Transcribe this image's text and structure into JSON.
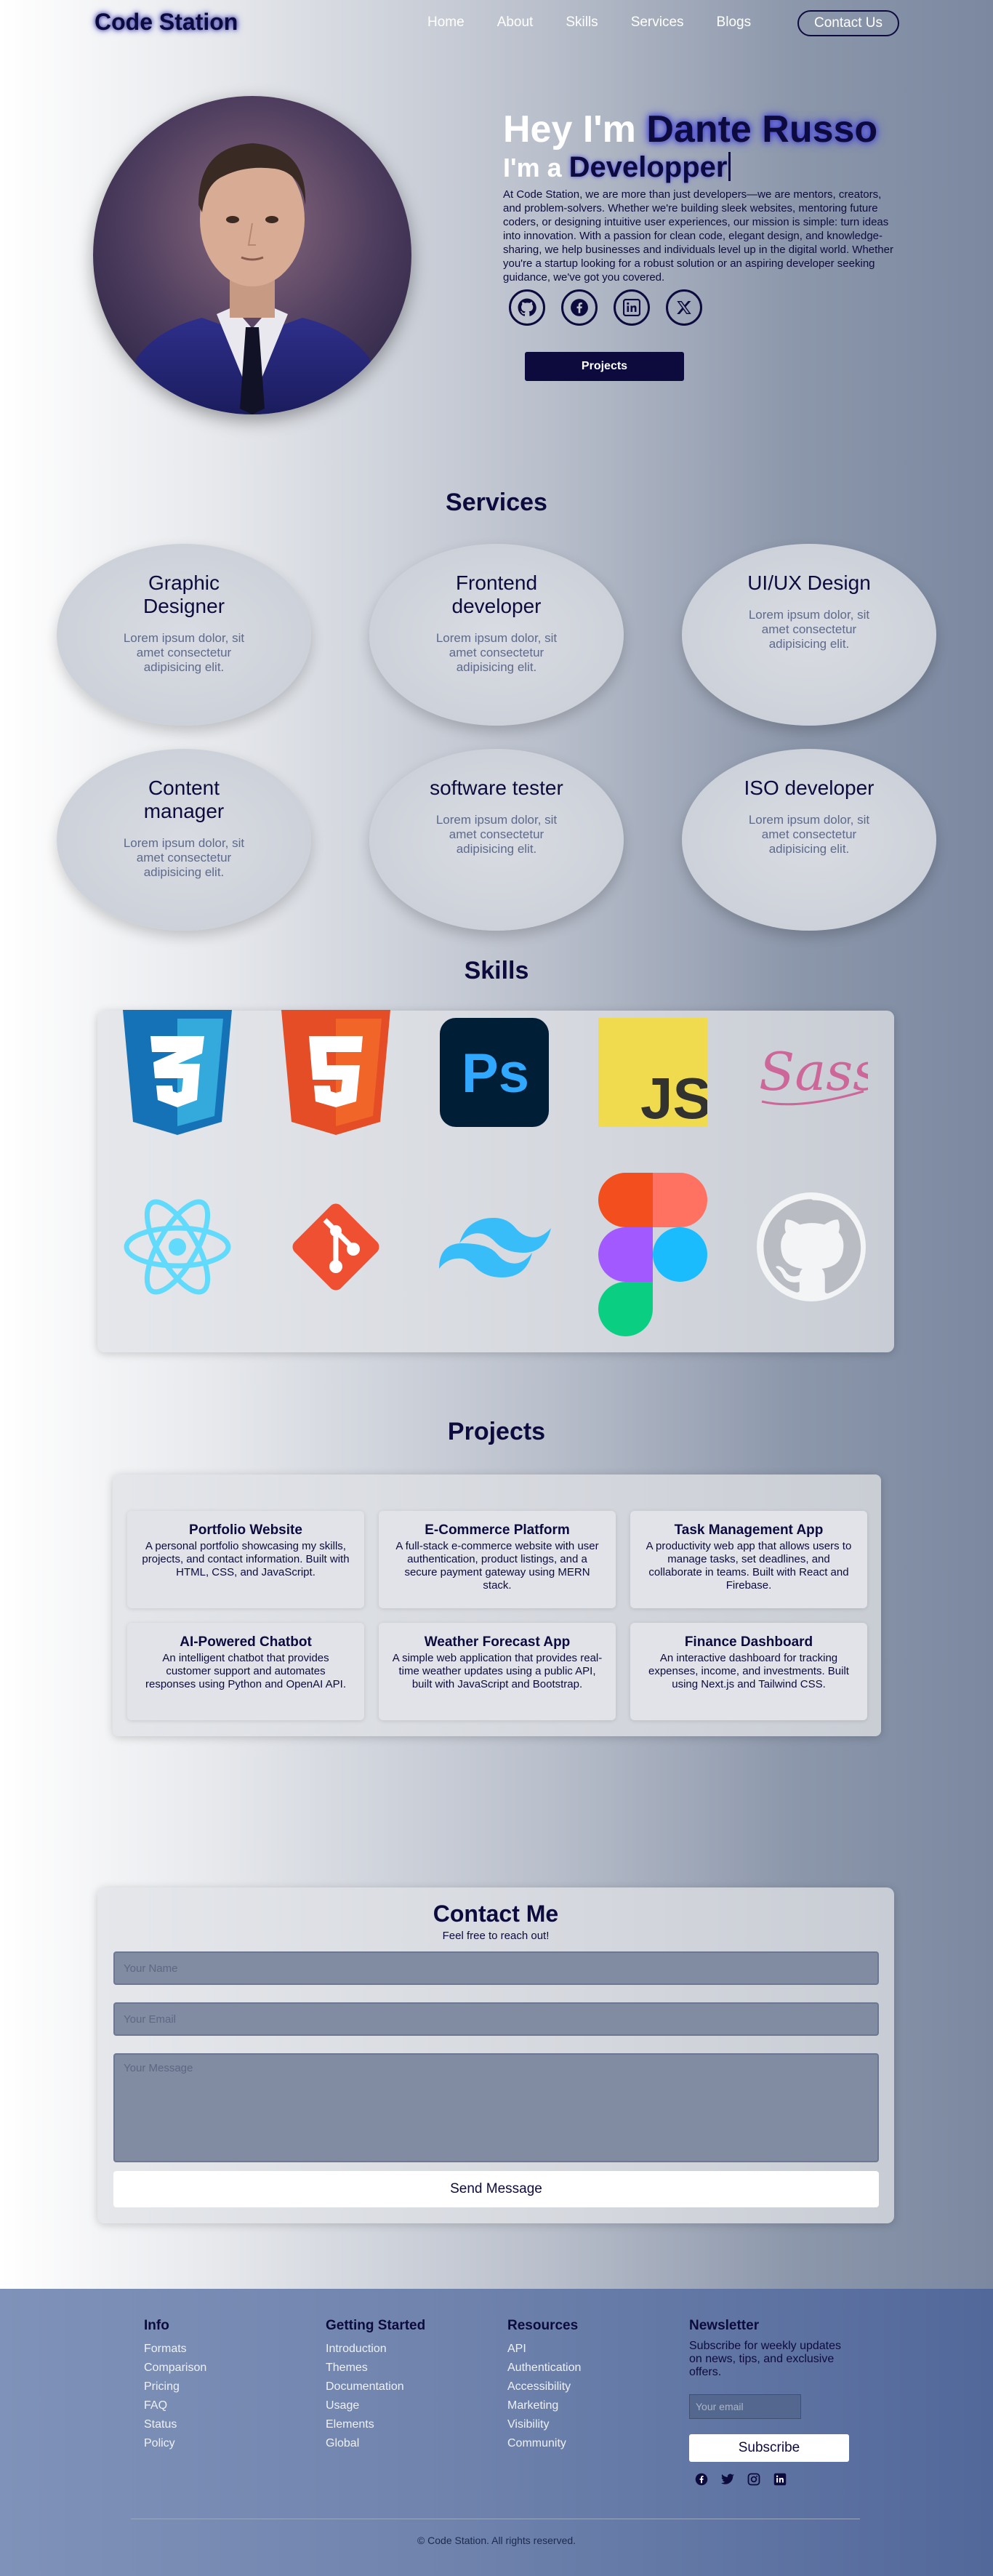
{
  "nav": {
    "logo": "Code Station",
    "links": [
      "Home",
      "About",
      "Skills",
      "Services",
      "Blogs"
    ],
    "contact_btn": "Contact Us"
  },
  "hero": {
    "greeting": "Hey I'm",
    "name": "Dante Russo",
    "im_a": "I'm a",
    "role": "Developper",
    "description": "At Code Station, we are more than just developers—we are mentors, creators, and problem-solvers. Whether we're building sleek websites, mentoring future coders, or designing intuitive user experiences, our mission is simple: turn ideas into innovation. With a passion for clean code, elegant design, and knowledge-sharing, we help businesses and individuals level up in the digital world. Whether you're a startup looking for a robust solution or an aspiring developer seeking guidance, we've got you covered.",
    "socials": [
      "github-icon",
      "facebook-icon",
      "linkedin-icon",
      "x-icon"
    ],
    "projects_btn": "Projects"
  },
  "services": {
    "title": "Services",
    "items": [
      {
        "name": "Graphic Designer",
        "desc": "Lorem ipsum dolor, sit amet consectetur adipisicing elit."
      },
      {
        "name": "Frontend developer",
        "desc": "Lorem ipsum dolor, sit amet consectetur adipisicing elit."
      },
      {
        "name": "UI/UX Design",
        "desc": "Lorem ipsum dolor, sit amet consectetur adipisicing elit."
      },
      {
        "name": "Content manager",
        "desc": "Lorem ipsum dolor, sit amet consectetur adipisicing elit."
      },
      {
        "name": "software tester",
        "desc": "Lorem ipsum dolor, sit amet consectetur adipisicing elit."
      },
      {
        "name": "ISO developer",
        "desc": "Lorem ipsum dolor, sit amet consectetur adipisicing elit."
      }
    ]
  },
  "skills": {
    "title": "Skills",
    "icons": [
      "css3-icon",
      "html5-icon",
      "photoshop-icon",
      "javascript-icon",
      "sass-icon",
      "react-icon",
      "git-icon",
      "tailwind-icon",
      "figma-icon",
      "github-icon"
    ],
    "ps_label": "Ps",
    "js_label": "JS",
    "sass_label": "Sass"
  },
  "projects": {
    "title": "Projects",
    "items": [
      {
        "title": "Portfolio Website",
        "desc": "A personal portfolio showcasing my skills, projects, and contact information. Built with HTML, CSS, and JavaScript."
      },
      {
        "title": "E-Commerce Platform",
        "desc": "A full-stack e-commerce website with user authentication, product listings, and a secure payment gateway using MERN stack."
      },
      {
        "title": "Task Management App",
        "desc": "A productivity web app that allows users to manage tasks, set deadlines, and collaborate in teams. Built with React and Firebase."
      },
      {
        "title": "AI-Powered Chatbot",
        "desc": "An intelligent chatbot that provides customer support and automates responses using Python and OpenAI API."
      },
      {
        "title": "Weather Forecast App",
        "desc": "A simple web application that provides real-time weather updates using a public API, built with JavaScript and Bootstrap."
      },
      {
        "title": "Finance Dashboard",
        "desc": "An interactive dashboard for tracking expenses, income, and investments. Built using Next.js and Tailwind CSS."
      }
    ]
  },
  "contact": {
    "title": "Contact Me",
    "subtitle": "Feel free to reach out!",
    "name_placeholder": "Your Name",
    "email_placeholder": "Your Email",
    "message_placeholder": "Your Message",
    "send_btn": "Send Message"
  },
  "footer": {
    "info": {
      "title": "Info",
      "links": [
        "Formats",
        "Comparison",
        "Pricing",
        "FAQ",
        "Status",
        "Policy"
      ]
    },
    "getting_started": {
      "title": "Getting Started",
      "links": [
        "Introduction",
        "Themes",
        "Documentation",
        "Usage",
        "Elements",
        "Global"
      ]
    },
    "resources": {
      "title": "Resources",
      "links": [
        "API",
        "Authentication",
        "Accessibility",
        "Marketing",
        "Visibility",
        "Community"
      ]
    },
    "newsletter": {
      "title": "Newsletter",
      "text": "Subscribe for weekly updates on news, tips, and exclusive offers.",
      "email_placeholder": "Your email",
      "subscribe_btn": "Subscribe"
    },
    "social_icons": [
      "facebook-icon",
      "twitter-icon",
      "instagram-icon",
      "linkedin-icon"
    ],
    "copyright": "© Code Station. All rights reserved."
  },
  "colors": {
    "primary": "#0d0b3d",
    "glow": "#5555ee",
    "footer": "#6f83ad"
  }
}
